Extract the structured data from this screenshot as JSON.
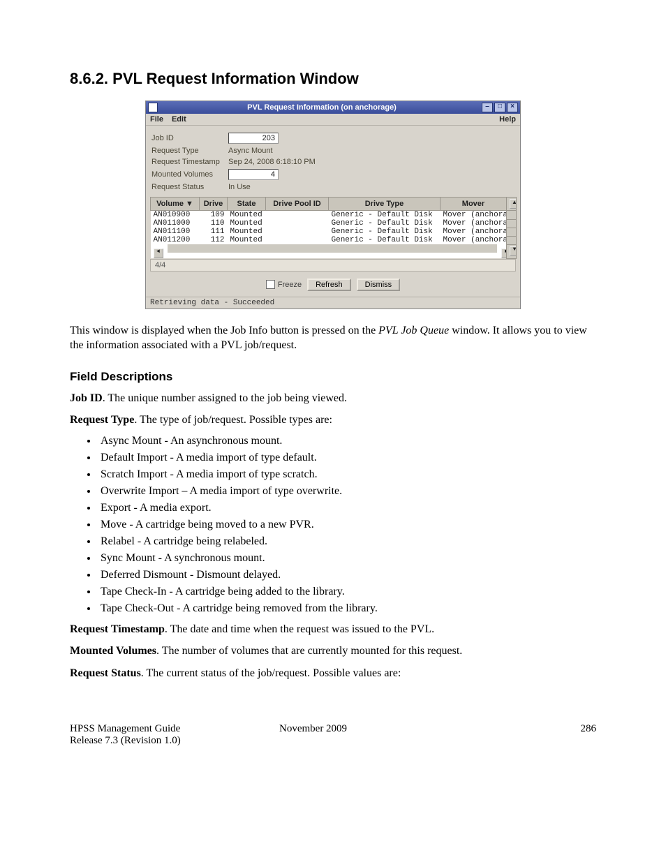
{
  "heading": "8.6.2.   PVL Request Information Window",
  "intro_html": "This window is displayed when the Job Info button is pressed on the <em>PVL Job Queue</em> window. It allows you to view the information associated with a PVL job/request.",
  "field_desc_heading": "Field Descriptions",
  "field_desc": [
    {
      "label": "Job ID",
      "text": ". The unique number assigned to the job being viewed."
    },
    {
      "label": "Request Type",
      "text": ". The type of job/request. Possible types are:"
    }
  ],
  "request_types": [
    "Async Mount - An asynchronous mount.",
    "Default Import - A media import of type default.",
    "Scratch Import - A media import of type scratch.",
    "Overwrite Import – A media import of type overwrite.",
    "Export - A media export.",
    "Move - A cartridge being moved to a new PVR.",
    "Relabel - A cartridge being relabeled.",
    "Sync Mount - A synchronous mount.",
    "Deferred Dismount - Dismount delayed.",
    "Tape Check-In - A cartridge being added to the library.",
    "Tape Check-Out - A cartridge being removed from the library."
  ],
  "trailing_paras": [
    {
      "label": "Request Timestamp",
      "text": ". The date and time when the request was issued to the PVL."
    },
    {
      "label": "Mounted Volumes",
      "text": ". The number of volumes that are currently mounted for this request."
    },
    {
      "label": "Request Status",
      "text": ". The current status of the job/request. Possible values are:"
    }
  ],
  "footer": {
    "guide": "HPSS Management Guide",
    "release": "Release 7.3 (Revision 1.0)",
    "date": "November 2009",
    "page": "286"
  },
  "window": {
    "title": "PVL Request Information (on anchorage)",
    "menus": {
      "file": "File",
      "edit": "Edit",
      "help": "Help"
    },
    "fields": {
      "job_id_label": "Job ID",
      "job_id": "203",
      "req_type_label": "Request Type",
      "req_type": "Async Mount",
      "ts_label": "Request Timestamp",
      "ts": "Sep 24, 2008 6:18:10 PM",
      "mv_label": "Mounted Volumes",
      "mv": "4",
      "status_label": "Request Status",
      "status": "In Use"
    },
    "headers": {
      "volume": "Volume ▼",
      "drive": "Drive",
      "state": "State",
      "pool": "Drive Pool ID",
      "type": "Drive Type",
      "mover": "Mover"
    },
    "rows": [
      {
        "volume": "AN010900",
        "drive": "109",
        "state": "Mounted",
        "pool": "",
        "type": "Generic - Default Disk",
        "mover": "Mover (anchorage)"
      },
      {
        "volume": "AN011000",
        "drive": "110",
        "state": "Mounted",
        "pool": "",
        "type": "Generic - Default Disk",
        "mover": "Mover (anchorage)"
      },
      {
        "volume": "AN011100",
        "drive": "111",
        "state": "Mounted",
        "pool": "",
        "type": "Generic - Default Disk",
        "mover": "Mover (anchorage)"
      },
      {
        "volume": "AN011200",
        "drive": "112",
        "state": "Mounted",
        "pool": "",
        "type": "Generic - Default Disk",
        "mover": "Mover (anchorage)"
      }
    ],
    "counter": "4/4",
    "buttons": {
      "freeze": "Freeze",
      "refresh": "Refresh",
      "dismiss": "Dismiss"
    },
    "status": "Retrieving data - Succeeded"
  }
}
